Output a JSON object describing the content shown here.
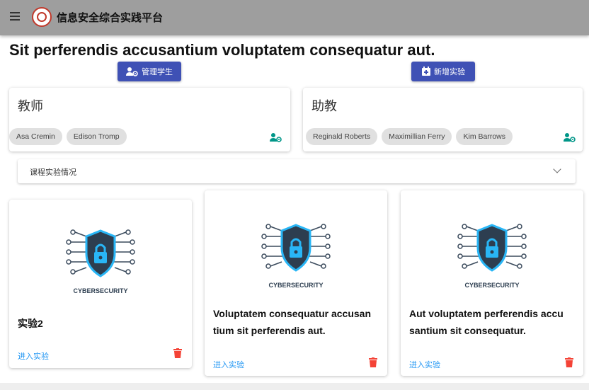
{
  "header": {
    "app_title": "信息安全综合实践平台",
    "menu_icon": "menu-icon",
    "logo_icon": "university-logo"
  },
  "page": {
    "title": "Sit perferendis accusantium voluptatem consequatur aut."
  },
  "actions": {
    "manage_students_label": "管理学生",
    "new_experiment_label": "新增实验"
  },
  "teachers": {
    "heading": "教师",
    "names": [
      "Asa Cremin",
      "Edison Tromp"
    ]
  },
  "assistants": {
    "heading": "助教",
    "names": [
      "Reginald Roberts",
      "Maximillian Ferry",
      "Kim Barrows"
    ]
  },
  "course_status": {
    "label": "课程实验情况"
  },
  "experiments": [
    {
      "image_label": "CYBERSECURITY",
      "title": "实验2",
      "enter_label": "进入实验"
    },
    {
      "image_label": "CYBERSECURITY",
      "title": "Voluptatem consequatur accusan tium sit perferendis aut.",
      "enter_label": "进入实验"
    },
    {
      "image_label": "CYBERSECURITY",
      "title": "Aut voluptatem perferendis accu santium sit consequatur.",
      "enter_label": "进入实验"
    }
  ],
  "colors": {
    "appbar": "#9e9e9e",
    "primary": "#3f51b5",
    "teal_icon": "#009688",
    "link": "#2196f3",
    "delete": "#f44336",
    "chip": "#e0e0e0"
  }
}
